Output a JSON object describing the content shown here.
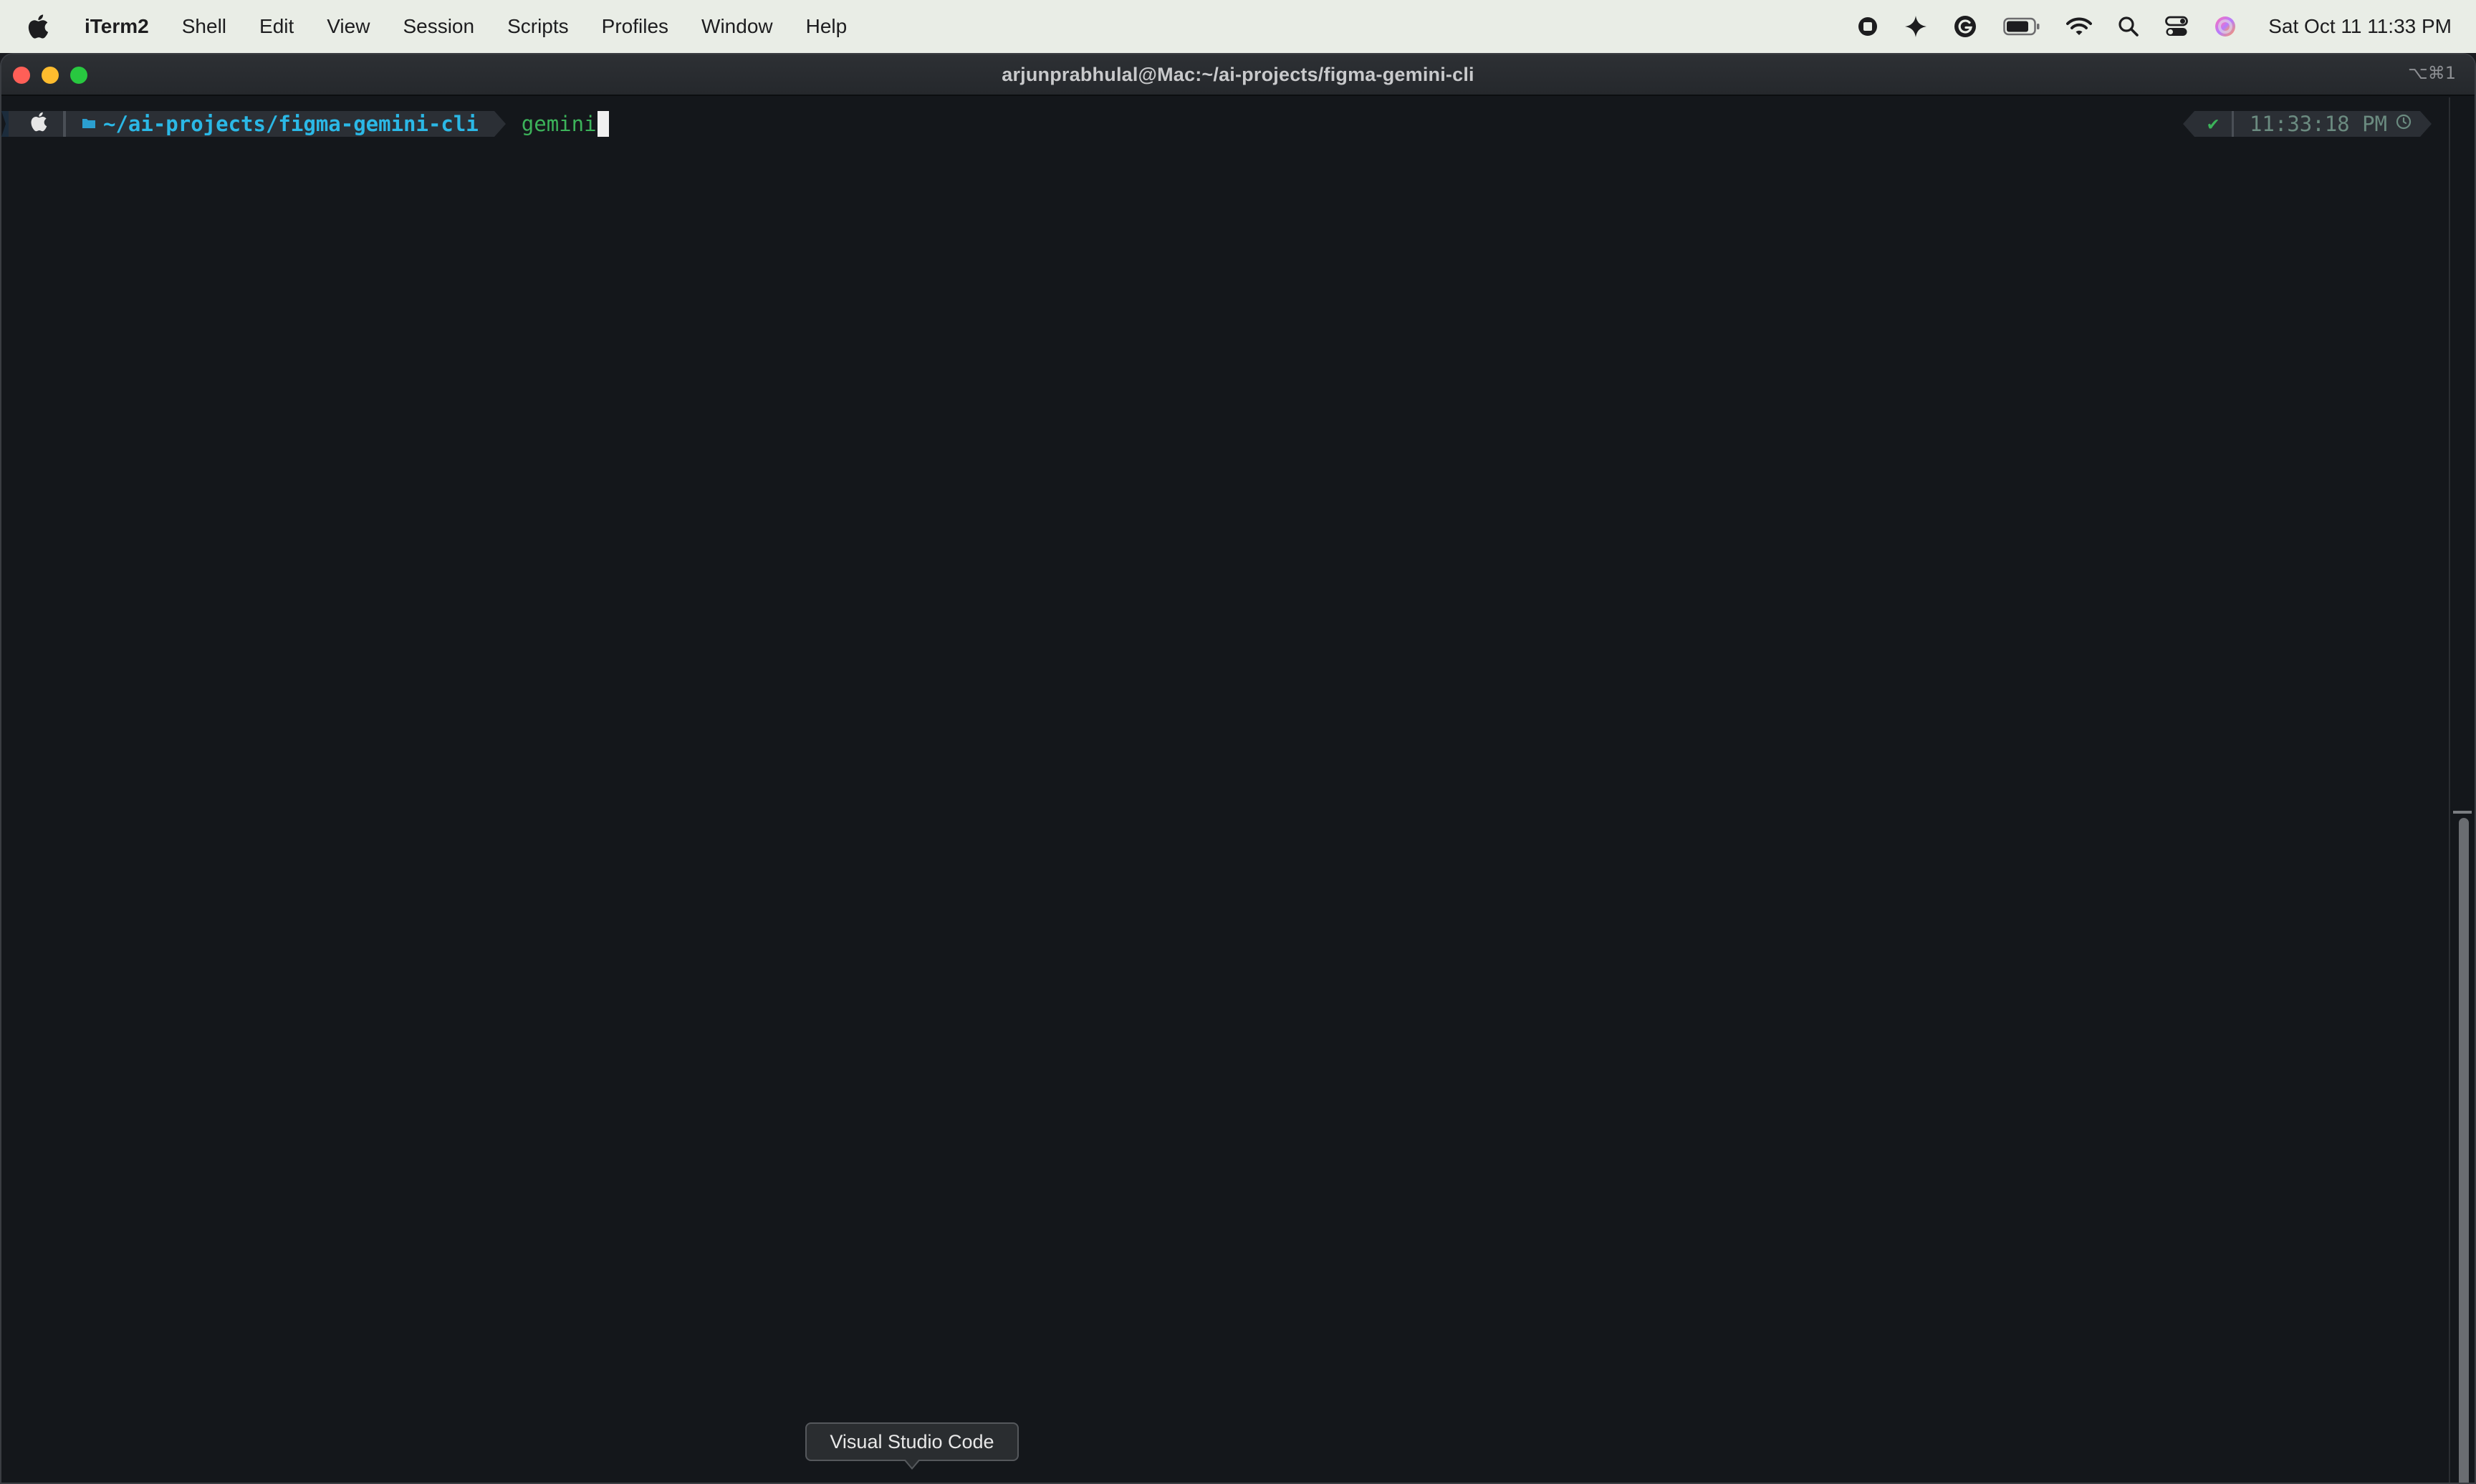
{
  "menubar": {
    "app_name": "iTerm2",
    "items": [
      {
        "label": "Shell"
      },
      {
        "label": "Edit"
      },
      {
        "label": "View"
      },
      {
        "label": "Session"
      },
      {
        "label": "Scripts"
      },
      {
        "label": "Profiles"
      },
      {
        "label": "Window"
      },
      {
        "label": "Help"
      }
    ],
    "status_icons": [
      "record-icon",
      "sparkle-icon",
      "grammarly-icon",
      "battery-icon",
      "wifi-icon",
      "spotlight-icon",
      "control-center-icon",
      "siri-icon"
    ],
    "clock": "Sat Oct 11  11:33 PM"
  },
  "window": {
    "title": "arjunprabhulal@Mac:~/ai-projects/figma-gemini-cli",
    "shortcut": "⌥⌘1"
  },
  "terminal": {
    "prompt": {
      "os_icon": "apple-icon",
      "dir_icon": "folder-icon",
      "dir_prefix": "~/",
      "dir_path": "ai-projects/figma-gemini-cli",
      "command": "gemini"
    },
    "rprompt": {
      "status": "✔",
      "time": "11:33:18 PM"
    }
  },
  "tooltip": {
    "label": "Visual Studio Code"
  },
  "colors": {
    "terminal_bg": "#14171b",
    "dir_text": "#2bb8e6",
    "command_text": "#3cb35a",
    "menubar_bg": "#e9ede6"
  }
}
